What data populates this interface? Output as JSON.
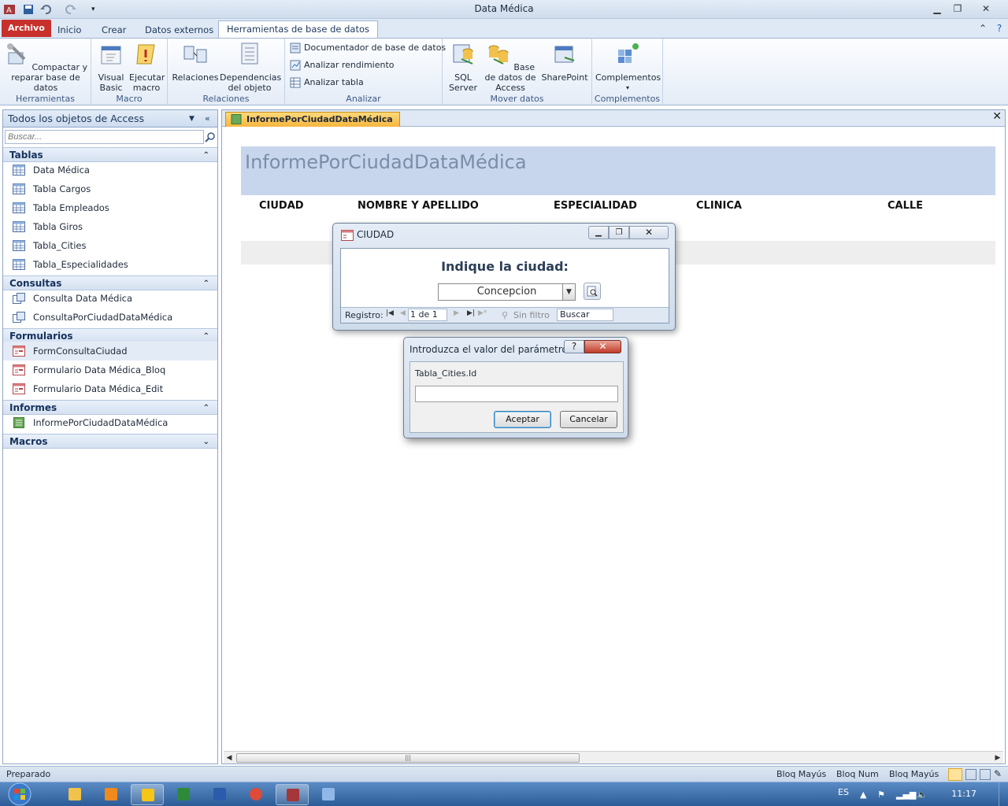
{
  "window": {
    "title": "Data Médica"
  },
  "ribbon": {
    "tabs": [
      "Archivo",
      "Inicio",
      "Crear",
      "Datos externos",
      "Herramientas de base de datos"
    ],
    "groups": {
      "herramientas": {
        "label": "Herramientas",
        "compactar": "Compactar y reparar base de datos"
      },
      "macro": {
        "label": "Macro",
        "visual_basic": "Visual Basic",
        "ejecutar_macro": "Ejecutar macro"
      },
      "relaciones": {
        "label": "Relaciones",
        "relaciones": "Relaciones",
        "dependencias": "Dependencias del objeto"
      },
      "analizar": {
        "label": "Analizar",
        "documentador": "Documentador de base de datos",
        "rendimiento": "Analizar rendimiento",
        "tabla": "Analizar tabla"
      },
      "mover": {
        "label": "Mover datos",
        "sql": "SQL Server",
        "access": "Base de datos de Access",
        "sharepoint": "SharePoint"
      },
      "complementos": {
        "label": "Complementos",
        "complementos": "Complementos"
      }
    }
  },
  "nav": {
    "header": "Todos los objetos de Access",
    "search_placeholder": "Buscar...",
    "categories": {
      "tablas": {
        "label": "Tablas",
        "items": [
          "Data Médica",
          "Tabla Cargos",
          "Tabla Empleados",
          "Tabla Giros",
          "Tabla_Cities",
          "Tabla_Especialidades"
        ]
      },
      "consultas": {
        "label": "Consultas",
        "items": [
          "Consulta Data Médica",
          "ConsultaPorCiudadDataMédica"
        ]
      },
      "formularios": {
        "label": "Formularios",
        "items": [
          "FormConsultaCiudad",
          "Formulario Data Médica_Bloq",
          "Formulario Data Médica_Edit"
        ]
      },
      "informes": {
        "label": "Informes",
        "items": [
          "InformePorCiudadDataMédica"
        ]
      },
      "macros": {
        "label": "Macros"
      }
    }
  },
  "document": {
    "tab": "InformePorCiudadDataMédica",
    "report_title": "InformePorCiudadDataMédica",
    "columns": [
      "CIUDAD",
      "NOMBRE Y APELLIDO",
      "ESPECIALIDAD",
      "CLINICA",
      "CALLE"
    ]
  },
  "ciudad_form": {
    "title": "CIUDAD",
    "prompt": "Indique la ciudad:",
    "selected_city": "Concepcion",
    "nav": {
      "registro_label": "Registro:",
      "position": "1 de 1",
      "filter": "Sin filtro",
      "search": "Buscar"
    }
  },
  "param_dialog": {
    "title": "Introduzca el valor del parámetro",
    "help": "?",
    "param_name": "Tabla_Cities.Id",
    "value": "",
    "ok_label": "Aceptar",
    "cancel_label": "Cancelar"
  },
  "status": {
    "left": "Preparado",
    "caps": "Bloq Mayús",
    "num": "Bloq Num",
    "caps2": "Bloq Mayús"
  },
  "taskbar": {
    "lang": "ES",
    "clock": "11:17"
  },
  "colors": {
    "accent_file_tab": "#c8302b",
    "ribbon_bg": "#e4ecf7",
    "report_header_bg": "#c7d6ec",
    "doc_tab": "#f5b63e"
  }
}
